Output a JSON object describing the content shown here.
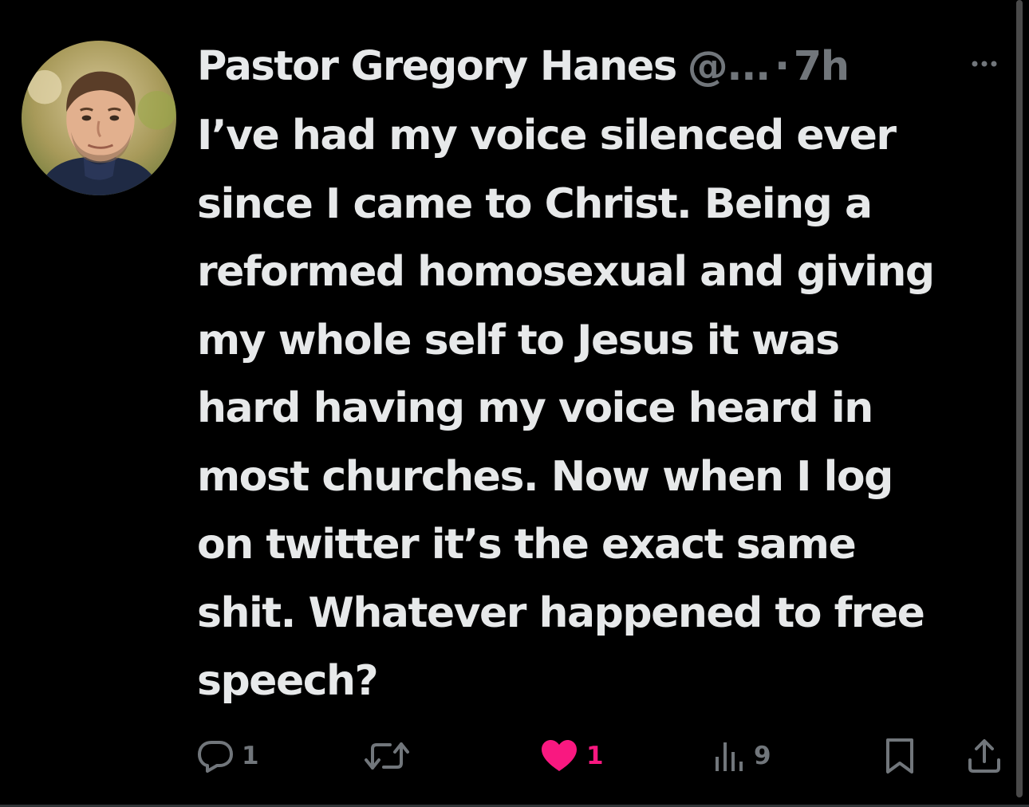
{
  "tweet": {
    "author": {
      "display_name": "Pastor Gregory Hanes",
      "handle": "@...",
      "avatar_icon": "profile-photo"
    },
    "separator": "·",
    "time": "7h",
    "more_icon": "more-icon",
    "text": "I’ve had my voice silenced ever\nsince I came to Christ. Being a\nreformed homosexual and giving\nmy whole self to Jesus it was\nhard having my voice heard in\nmost churches. Now when I log\non twitter it’s the exact same\nshit. Whatever happened to free\nspeech?",
    "actions": {
      "reply": {
        "icon": "reply-icon",
        "count": "1"
      },
      "retweet": {
        "icon": "retweet-icon",
        "count": ""
      },
      "like": {
        "icon": "heart-icon",
        "count": "1",
        "liked": true
      },
      "views": {
        "icon": "views-icon",
        "count": "9"
      },
      "bookmark": {
        "icon": "bookmark-icon"
      },
      "share": {
        "icon": "share-icon"
      }
    }
  },
  "colors": {
    "background": "#000000",
    "text_primary": "#e7e9ea",
    "text_secondary": "#71767b",
    "like_accent": "#f91880"
  }
}
